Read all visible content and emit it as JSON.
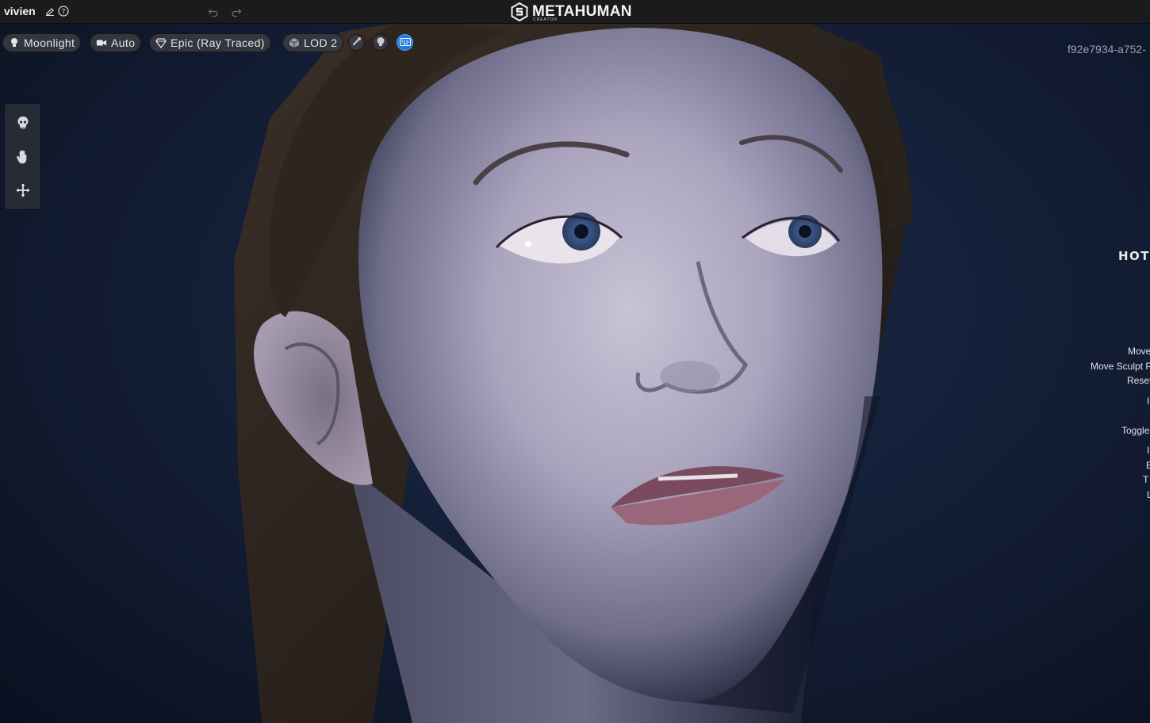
{
  "titlebar": {
    "project_name": "vivien",
    "logo_text": "METAHUMAN",
    "logo_subtext": "CREATOR"
  },
  "toolbar": {
    "lighting": "Moonlight",
    "camera": "Auto",
    "quality": "Epic (Ray Traced)",
    "lod": "LOD 2"
  },
  "viewport": {
    "session_id": "f92e7934-a752-"
  },
  "hotkeys": {
    "title": "HOTK",
    "rows": [
      "Move",
      "Move Sculpt P",
      "Reset",
      "I",
      "Toggle",
      "I",
      "E",
      "T",
      "L"
    ]
  },
  "colors": {
    "accent": "#1e7bdc",
    "titlebar": "#1b1b1d",
    "background": "#15203a"
  }
}
